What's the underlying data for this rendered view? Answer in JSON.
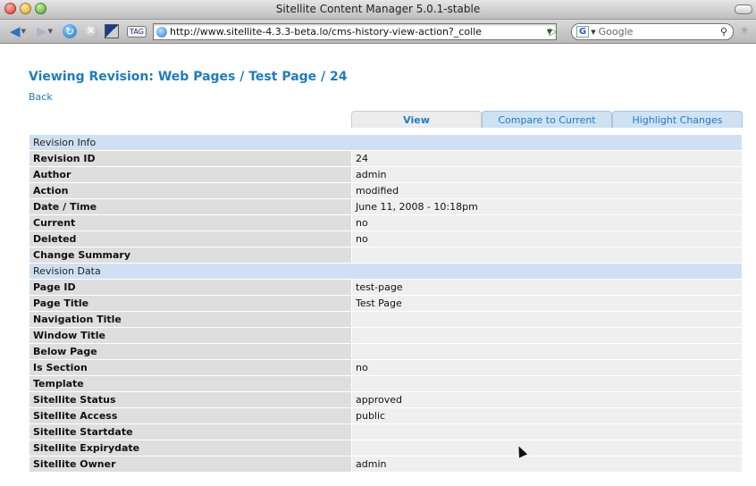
{
  "window": {
    "title": "Sitellite Content Manager 5.0.1-stable"
  },
  "toolbar": {
    "url": "http://www.sitellite-4.3.3-beta.lo/cms-history-view-action?_colle",
    "search_engine_label": "G",
    "search_placeholder": "Google",
    "tag_label": "TAG"
  },
  "page": {
    "heading": "Viewing Revision: Web Pages / Test Page / 24",
    "back_link": "Back",
    "tabs": [
      {
        "label": "View",
        "active": true
      },
      {
        "label": "Compare to Current",
        "active": false
      },
      {
        "label": "Highlight Changes",
        "active": false
      }
    ]
  },
  "revision_info": {
    "header": "Revision Info",
    "rows": [
      {
        "label": "Revision ID",
        "value": "24"
      },
      {
        "label": "Author",
        "value": "admin"
      },
      {
        "label": "Action",
        "value": "modified"
      },
      {
        "label": "Date / Time",
        "value": "June 11, 2008 - 10:18pm"
      },
      {
        "label": "Current",
        "value": "no"
      },
      {
        "label": "Deleted",
        "value": "no"
      },
      {
        "label": "Change Summary",
        "value": ""
      }
    ]
  },
  "revision_data": {
    "header": "Revision Data",
    "rows": [
      {
        "label": "Page ID",
        "value": "test-page"
      },
      {
        "label": "Page Title",
        "value": "Test Page"
      },
      {
        "label": "Navigation Title",
        "value": ""
      },
      {
        "label": "Window Title",
        "value": ""
      },
      {
        "label": "Below Page",
        "value": ""
      },
      {
        "label": "Is Section",
        "value": "no"
      },
      {
        "label": "Template",
        "value": ""
      },
      {
        "label": "Sitellite Status",
        "value": "approved"
      },
      {
        "label": "Sitellite Access",
        "value": "public"
      },
      {
        "label": "Sitellite Startdate",
        "value": ""
      },
      {
        "label": "Sitellite Expirydate",
        "value": ""
      },
      {
        "label": "Sitellite Owner",
        "value": "admin"
      }
    ]
  },
  "colors": {
    "accent": "#1d7cc0",
    "section_bg": "#cfe0f3",
    "label_bg": "#dedede",
    "value_bg": "#efefef"
  }
}
